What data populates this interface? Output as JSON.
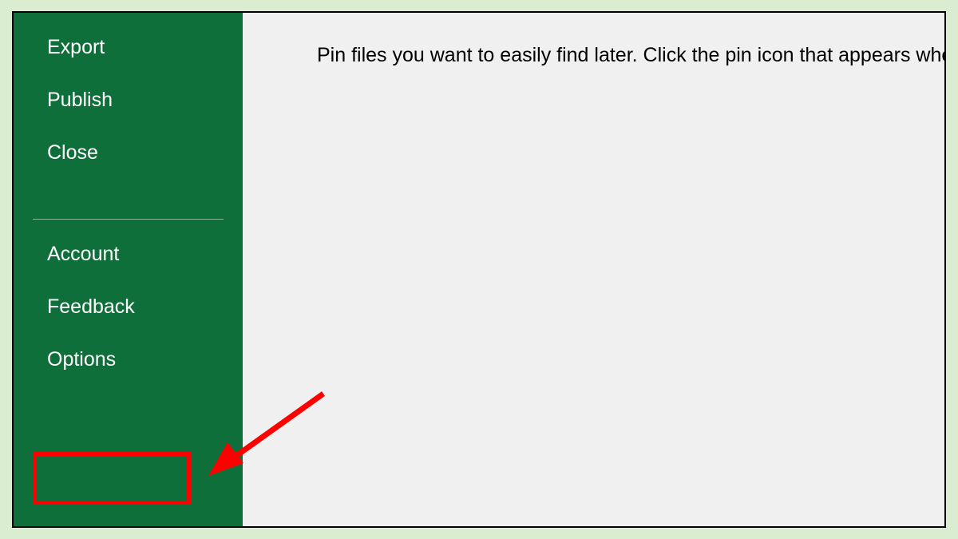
{
  "sidebar": {
    "group1": [
      {
        "label": "Export"
      },
      {
        "label": "Publish"
      },
      {
        "label": "Close"
      }
    ],
    "group2": [
      {
        "label": "Account"
      },
      {
        "label": "Feedback"
      },
      {
        "label": "Options"
      }
    ]
  },
  "main": {
    "hint": "Pin files you want to easily find later. Click the pin icon that appears when y"
  },
  "annotation": {
    "highlight_target": "Options",
    "arrow_color": "#ff0000"
  }
}
